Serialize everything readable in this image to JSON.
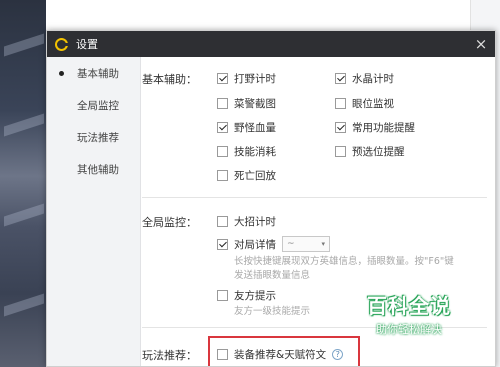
{
  "window": {
    "title": "设置",
    "close_label": "×"
  },
  "sidebar": {
    "items": [
      {
        "label": "基本辅助",
        "active": true
      },
      {
        "label": "全局监控",
        "active": false
      },
      {
        "label": "玩法推荐",
        "active": false
      },
      {
        "label": "其他辅助",
        "active": false
      }
    ]
  },
  "basic": {
    "label": "基本辅助：",
    "options": [
      {
        "label": "打野计时",
        "checked": true
      },
      {
        "label": "水晶计时",
        "checked": true
      },
      {
        "label": "菜警截图",
        "checked": false
      },
      {
        "label": "眼位监视",
        "checked": false
      },
      {
        "label": "野怪血量",
        "checked": true
      },
      {
        "label": "常用功能提醒",
        "checked": true
      },
      {
        "label": "技能消耗",
        "checked": false
      },
      {
        "label": "预选位提醒",
        "checked": false
      },
      {
        "label": "死亡回放",
        "checked": false
      }
    ]
  },
  "monitor": {
    "label": "全局监控：",
    "opt_ult": {
      "label": "大招计时",
      "checked": false
    },
    "opt_detail": {
      "label": "对局详情",
      "checked": true,
      "select_value": "~"
    },
    "detail_hint_1": "长按快捷键展现双方英雄信息，插眼数量。按\"F6\"键",
    "detail_hint_2": "发送插眼数量信息",
    "opt_ally": {
      "label": "友方提示",
      "checked": false
    },
    "ally_hint": "友方一级技能提示"
  },
  "play": {
    "label": "玩法推荐：",
    "opt_equip": {
      "label": "装备推荐&天赋符文",
      "checked": false
    },
    "help": "?"
  },
  "watermark": {
    "main": "百科全说",
    "sub": "助你轻松解决"
  },
  "colors": {
    "titlebar": "#2e2f33",
    "logo": "#f3c200",
    "highlight": "#d9363e",
    "watermark": "#2aa55a"
  }
}
